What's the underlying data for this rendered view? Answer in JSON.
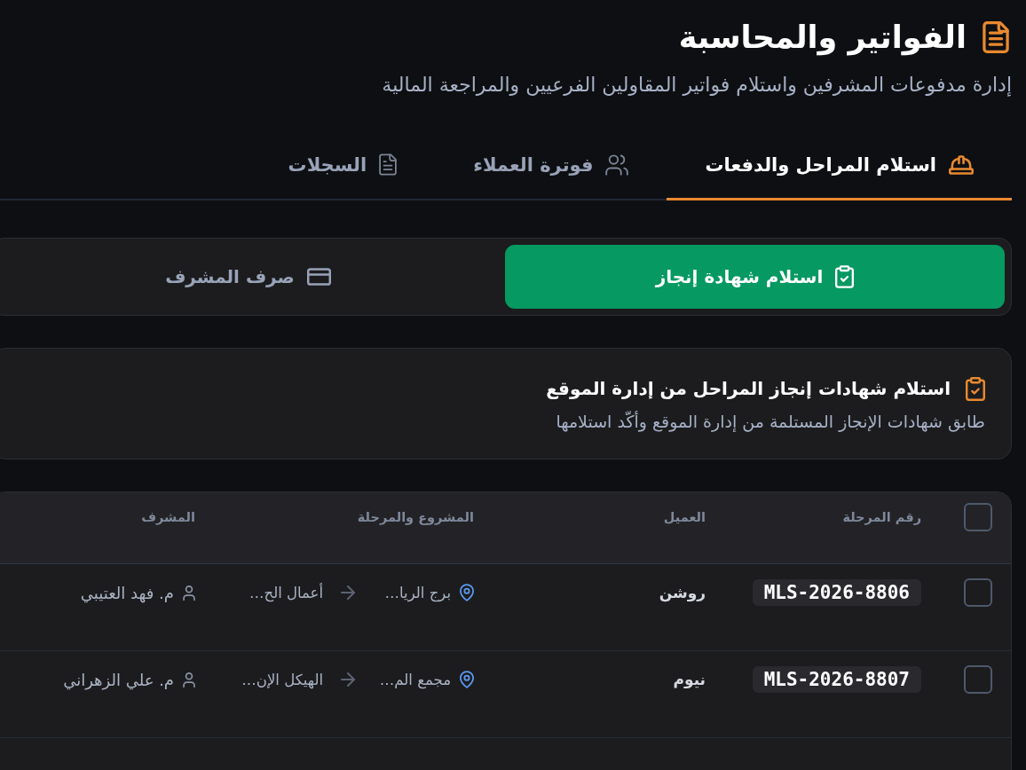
{
  "header": {
    "title": "الفواتير والمحاسبة",
    "subtitle": "إدارة مدفوعات المشرفين واستلام فواتير المقاولين الفرعيين والمراجعة المالية"
  },
  "tabs": [
    {
      "label": "استلام المراحل والدفعات",
      "selected": true
    },
    {
      "label": "فوترة العملاء",
      "selected": false
    },
    {
      "label": "السجلات",
      "selected": false
    }
  ],
  "modes": [
    {
      "label": "استلام شهادة إنجاز",
      "selected": true
    },
    {
      "label": "صرف المشرف",
      "selected": false
    }
  ],
  "section": {
    "title": "استلام شهادات إنجاز المراحل من إدارة الموقع",
    "description": "طابق شهادات الإنجاز المستلمة من إدارة الموقع وأكّد استلامها"
  },
  "table": {
    "select_all": {
      "checked": false
    },
    "columns": [
      "رقم المرحلة",
      "العميل",
      "المشروع والمرحلة",
      "المشرف"
    ],
    "rows": [
      {
        "checked": false,
        "phase_number": "MLS-2026-8806",
        "client": "روشن",
        "project": "برج الريا…",
        "phase": "أعمال الح…",
        "supervisor": "م. فهد العتيبي"
      },
      {
        "checked": false,
        "phase_number": "MLS-2026-8807",
        "client": "نيوم",
        "project": "مجمع الم…",
        "phase": "الهيكل الإن…",
        "supervisor": "م. علي الزهراني"
      }
    ]
  }
}
